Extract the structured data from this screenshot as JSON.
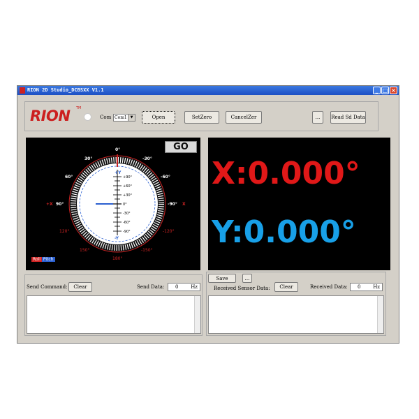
{
  "window": {
    "title": "RION 2D Studio_DCBSXX V1.1",
    "minimize_glyph": "_",
    "maximize_glyph": "□",
    "close_glyph": "×"
  },
  "toolbar": {
    "logo": "RION",
    "trademark": "TM",
    "com_label": "Com",
    "com_value": "Com1",
    "open_label": "Open",
    "setzero_label": "SetZero",
    "cancelzero_label": "CancelZer",
    "more_label": "...",
    "read_sd_label": "Read Sd Data"
  },
  "gauge": {
    "go_label": "GO",
    "angles": {
      "top": "0°",
      "l30": "30°",
      "r30": "-30°",
      "l60": "60°",
      "r60": "-60°",
      "l90": "90°",
      "r90": "-90°",
      "l120": "120°",
      "r120": "-120°",
      "l150": "150°",
      "r150": "-150°",
      "bottom": "180°"
    },
    "plus_x": "+X",
    "minus_x": "X",
    "plus_y": "+Y",
    "minus_y": "-Y",
    "ticks": [
      "+90°",
      "+60°",
      "+30°",
      "0°",
      "-30°",
      "-60°",
      "-90°"
    ],
    "legend_roll": "Roll",
    "legend_pitch": "Pitch"
  },
  "readout": {
    "x": "X:0.000°",
    "y": "Y:0.000°",
    "x_color": "#e01818",
    "y_color": "#18a0e8"
  },
  "send": {
    "label": "Send Command:",
    "clear_label": "Clear",
    "data_label": "Send Data:",
    "count": "0",
    "unit": "Hz"
  },
  "receive": {
    "save_label": "Save",
    "more_label": "...",
    "label": "Received Sensor Data:",
    "clear_label": "Clear",
    "data_label": "Received Data:",
    "count": "0",
    "unit": "Hz"
  }
}
